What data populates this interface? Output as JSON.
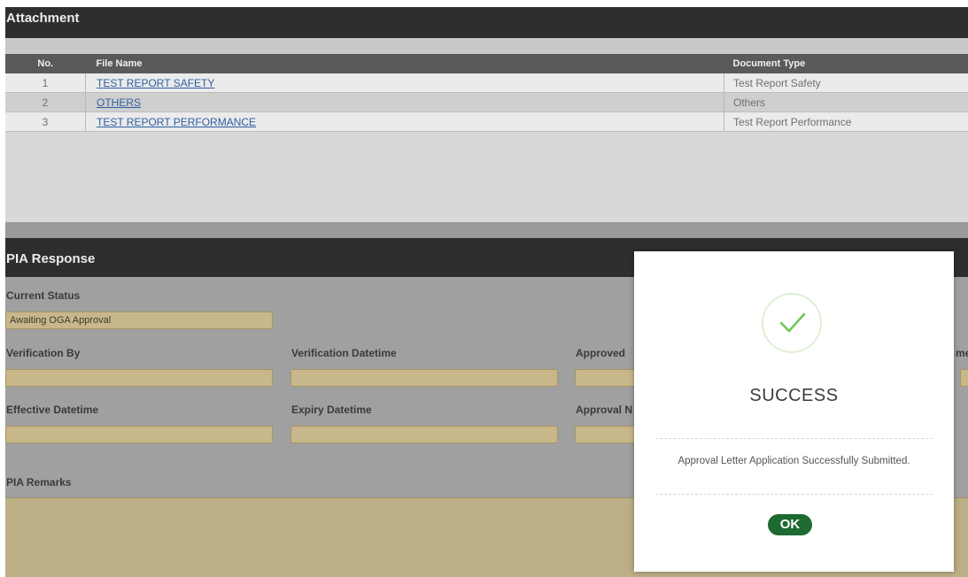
{
  "attachment": {
    "title": "Attachment",
    "columns": {
      "no": "No.",
      "file_name": "File Name",
      "document_type": "Document Type"
    },
    "rows": [
      {
        "no": "1",
        "file_name": "TEST REPORT SAFETY",
        "document_type": "Test Report Safety"
      },
      {
        "no": "2",
        "file_name": "OTHERS",
        "document_type": "Others"
      },
      {
        "no": "3",
        "file_name": "TEST REPORT PERFORMANCE",
        "document_type": "Test Report Performance"
      }
    ]
  },
  "pia": {
    "title": "PIA Response",
    "current_status_label": "Current Status",
    "current_status_value": "Awaiting OGA Approval",
    "verification_by_label": "Verification By",
    "verification_datetime_label": "Verification Datetime",
    "approved_label": "Approved",
    "clipped_label": "me",
    "effective_datetime_label": "Effective Datetime",
    "expiry_datetime_label": "Expiry Datetime",
    "approval_label": "Approval N",
    "remarks_label": "PIA Remarks"
  },
  "dialog": {
    "title": "SUCCESS",
    "message": "Approval Letter Application Successfully Submitted.",
    "ok_label": "OK"
  },
  "colors": {
    "header": "#2e2e2e",
    "field": "#c7b78a",
    "ok_button": "#1e6a31",
    "check": "#6cc655"
  },
  "icons": {
    "success": "checkmark-icon"
  }
}
